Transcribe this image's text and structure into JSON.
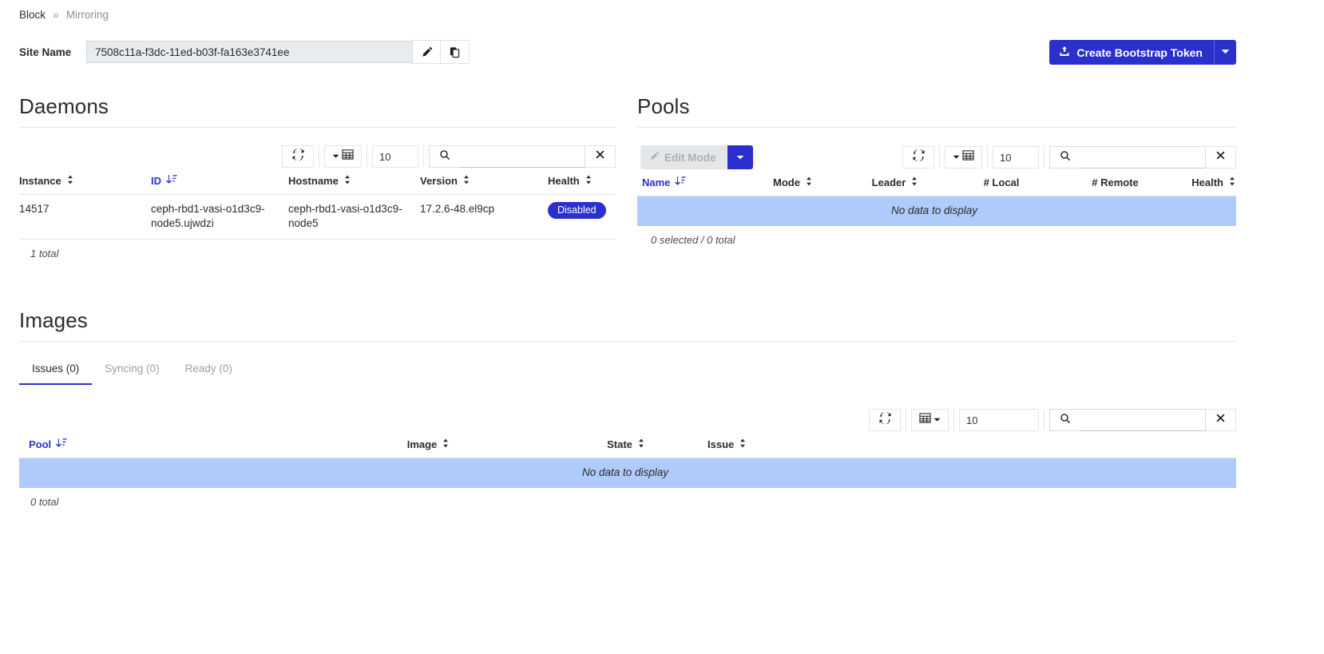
{
  "breadcrumb": {
    "root": "Block",
    "separator": "»",
    "current": "Mirroring"
  },
  "site": {
    "label": "Site Name",
    "value": "7508c11a-f3dc-11ed-b03f-fa163e3741ee",
    "edit_icon": "pencil-icon",
    "copy_icon": "copy-icon"
  },
  "header_actions": {
    "create_token_label": "Create Bootstrap Token",
    "create_token_icon": "upload-icon",
    "caret_icon": "chevron-down-icon",
    "accent_color": "#2b30cc"
  },
  "daemons": {
    "title": "Daemons",
    "toolbar": {
      "refresh_icon": "refresh-icon",
      "columns_icon": "table-columns-icon",
      "page_size": "10",
      "search_icon": "search-icon",
      "search_value": "",
      "clear_icon": "close-icon"
    },
    "columns": [
      "Instance",
      "ID",
      "Hostname",
      "Version",
      "Health"
    ],
    "active_sort_column": "ID",
    "rows": [
      {
        "instance": "14517",
        "id": "ceph-rbd1-vasi-o1d3c9-node5.ujwdzi",
        "hostname": "ceph-rbd1-vasi-o1d3c9-node5",
        "version": "17.2.6-48.el9cp",
        "health": "Disabled",
        "health_color": "#2b30cc"
      }
    ],
    "footer": "1 total"
  },
  "pools": {
    "title": "Pools",
    "toolbar": {
      "edit_mode_label": "Edit Mode",
      "edit_mode_icon": "pencil-icon",
      "edit_mode_caret": "chevron-down-icon",
      "refresh_icon": "refresh-icon",
      "columns_icon": "table-columns-icon",
      "page_size": "10",
      "search_icon": "search-icon",
      "search_value": "",
      "clear_icon": "close-icon"
    },
    "columns": [
      "Name",
      "Mode",
      "Leader",
      "# Local",
      "# Remote",
      "Health"
    ],
    "active_sort_column": "Name",
    "empty_message": "No data to display",
    "footer": "0 selected / 0 total"
  },
  "images": {
    "title": "Images",
    "tabs": [
      {
        "label": "Issues (0)",
        "active": true
      },
      {
        "label": "Syncing (0)",
        "active": false
      },
      {
        "label": "Ready (0)",
        "active": false
      }
    ],
    "toolbar": {
      "refresh_icon": "refresh-icon",
      "columns_icon": "table-columns-icon",
      "page_size": "10",
      "search_icon": "search-icon",
      "search_value": "",
      "clear_icon": "close-icon"
    },
    "columns": [
      "Pool",
      "Image",
      "State",
      "Issue"
    ],
    "active_sort_column": "Pool",
    "empty_message": "No data to display",
    "footer": "0 total"
  }
}
